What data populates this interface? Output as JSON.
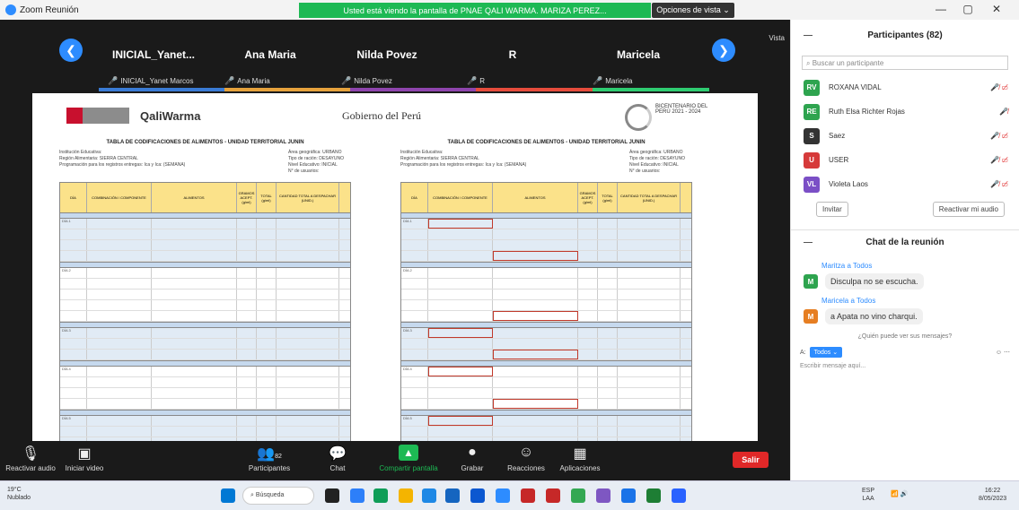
{
  "window": {
    "title": "Zoom Reunión",
    "share_banner": "Usted está viendo la pantalla de PNAE QALI WARMA. MARIZA PEREZ...",
    "view_options": "Opciones de vista ⌄",
    "minimize": "—",
    "maximize": "▢",
    "close": "✕"
  },
  "thumbnails": {
    "vista_label": "Vista",
    "items": [
      {
        "name": "INICIAL_Yanet...",
        "sub": "INICIAL_Yanet Marcos",
        "color": "#3a7bd5"
      },
      {
        "name": "Ana Maria",
        "sub": "Ana Maria",
        "color": "#e6a23c"
      },
      {
        "name": "Nilda Povez",
        "sub": "Nilda Povez",
        "color": "#8e44ad"
      },
      {
        "name": "R",
        "sub": "R",
        "color": "#e74c3c"
      },
      {
        "name": "Maricela",
        "sub": "Maricela",
        "color": "#2ecc71"
      }
    ]
  },
  "document": {
    "qali_warma": "QaliWarma",
    "gobierno": "Gobierno del Perú",
    "bicentenario": "BICENTENARIO DEL PERÚ 2021 - 2024",
    "left_table": {
      "title": "TABLA DE CODIFICACIONES DE ALIMENTOS - UNIDAD TERRITORIAL JUNIN",
      "meta_left": [
        "Institución Educativa:",
        "Región Alimentaria: SIERRA CENTRAL",
        "Programación para los registros entregas: Ica y Ica: (SEMANA)"
      ],
      "meta_right": [
        "Área geográfica: URBANO",
        "Tipo de ración: DESAYUNO",
        "Nivel Educativo: INICIAL",
        "N° de usuarios:"
      ]
    },
    "right_table": {
      "title": "TABLA DE CODIFICACIONES DE ALIMENTOS - UNIDAD TERRITORIAL JUNIN",
      "meta_left": [
        "Institución Educativa:",
        "Región Alimentaria: SIERRA CENTRAL",
        "Programación para los registros entregas: Ica y Ica: (SEMANA)"
      ],
      "meta_right": [
        "Área geográfica: URBANO",
        "Tipo de ración: DESAYUNO",
        "Nivel Educativo: INICIAL",
        "N° de usuarios:"
      ]
    },
    "headers": [
      "DÍA",
      "COMBINACIÓN / COMPONENTE",
      "ALIMENTOS",
      "GRAMOS ACEPT. (g/ml)",
      "TOTAL (g/ml)",
      "CANTIDAD TOTAL A DESPACHAR (UNID.)"
    ],
    "days": [
      "DÍA 1",
      "DÍA 2",
      "DÍA 3",
      "DÍA 4",
      "DÍA 5"
    ]
  },
  "toolbar": {
    "items": [
      {
        "icon": "mic-muted-icon",
        "label": "Reactivar audio"
      },
      {
        "icon": "video-off-icon",
        "label": "Iniciar video"
      },
      {
        "icon": "participants-icon",
        "label": "Participantes",
        "count": "82"
      },
      {
        "icon": "chat-icon",
        "label": "Chat"
      },
      {
        "icon": "share-screen-icon",
        "label": "Compartir pantalla"
      },
      {
        "icon": "record-icon",
        "label": "Grabar"
      },
      {
        "icon": "reactions-icon",
        "label": "Reacciones"
      },
      {
        "icon": "apps-icon",
        "label": "Aplicaciones"
      }
    ],
    "leave": "Salir"
  },
  "panel": {
    "title": "Participantes (82)",
    "search_placeholder": "Buscar un participante",
    "participants": [
      {
        "initials": "RV",
        "name": "ROXANA VIDAL",
        "color": "#2ea44f",
        "icons": "🎤̸ ▭̸"
      },
      {
        "initials": "RE",
        "name": "Ruth Elsa Richter Rojas",
        "color": "#2ea44f",
        "icons": "🎤̸"
      },
      {
        "initials": "S",
        "name": "Saez",
        "color": "#333333",
        "icons": "🎤̸ ▭̸"
      },
      {
        "initials": "U",
        "name": "USER",
        "color": "#d63a3a",
        "icons": "🎤̸ ▭̸"
      },
      {
        "initials": "VL",
        "name": "Violeta Laos",
        "color": "#7b4fc6",
        "icons": "🎤̸ ▭̸"
      }
    ],
    "invite": "Invitar",
    "unmute_me": "Reactivar mi audio"
  },
  "chat": {
    "title": "Chat de la reunión",
    "messages": [
      {
        "from": "Maritza a Todos",
        "initial": "M",
        "color": "#2ea44f",
        "text": "Disculpa no se escucha."
      },
      {
        "from": "Maricela a Todos",
        "initial": "M",
        "color": "#e67e22",
        "text": "a Apata no vino charqui."
      }
    ],
    "who_can_see": "¿Quién puede ver sus mensajes?",
    "to_label": "A:",
    "to_value": "Todos ⌄",
    "placeholder": "Escribir mensaje aquí..."
  },
  "taskbar": {
    "weather_temp": "19°C",
    "weather_desc": "Nublado",
    "search": "Búsqueda",
    "lang_top": "ESP",
    "lang_bottom": "LAA",
    "time": "16:22",
    "date": "8/05/2023"
  }
}
